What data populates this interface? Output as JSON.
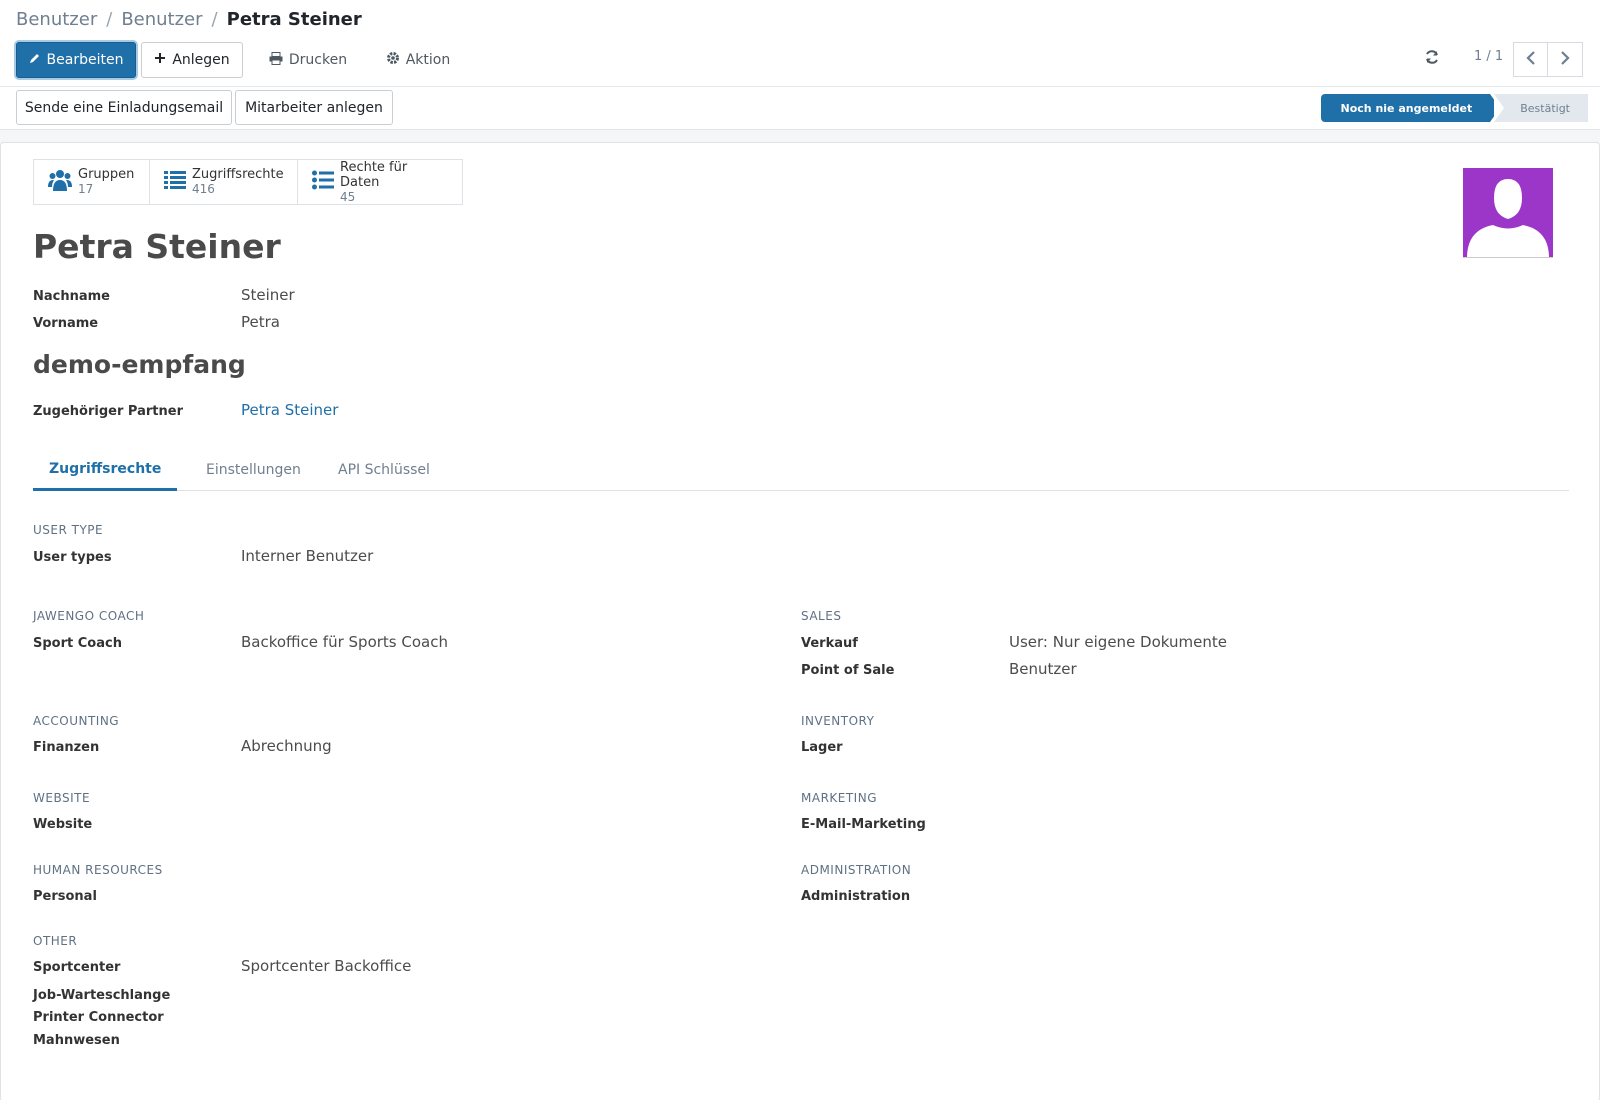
{
  "breadcrumb": {
    "items": [
      "Benutzer",
      "Benutzer",
      "Petra Steiner"
    ]
  },
  "toolbar": {
    "edit": "Bearbeiten",
    "create": "Anlegen",
    "print": "Drucken",
    "action": "Aktion"
  },
  "pager": {
    "value": "1 / 1"
  },
  "header_buttons": {
    "invite": "Sende eine Einladungsemail",
    "employee": "Mitarbeiter anlegen"
  },
  "status": {
    "current": "Noch nie angemeldet",
    "next": "Bestätigt"
  },
  "stats": [
    {
      "label": "Gruppen",
      "value": "17",
      "icon": "users-icon"
    },
    {
      "label": "Zugriffsrechte",
      "value": "416",
      "icon": "list-icon"
    },
    {
      "label": "Rechte für Daten",
      "value": "45",
      "icon": "list-ul-icon"
    }
  ],
  "user": {
    "name": "Petra Steiner",
    "lastname_label": "Nachname",
    "lastname": "Steiner",
    "firstname_label": "Vorname",
    "firstname": "Petra",
    "login": "demo-empfang",
    "partner_label": "Zugehöriger Partner",
    "partner": "Petra Steiner"
  },
  "tabs": [
    "Zugriffsrechte",
    "Einstellungen",
    "API Schlüssel"
  ],
  "access": {
    "user_type": {
      "head": "USER TYPE",
      "label": "User types",
      "value": "Interner Benutzer"
    },
    "coach": {
      "head": "JAWENGO COACH",
      "label": "Sport Coach",
      "value": "Backoffice für Sports Coach"
    },
    "sales": {
      "head": "SALES",
      "verkauf_label": "Verkauf",
      "verkauf_value": "User: Nur eigene Dokumente",
      "pos_label": "Point of Sale",
      "pos_value": "Benutzer"
    },
    "accounting": {
      "head": "ACCOUNTING",
      "label": "Finanzen",
      "value": "Abrechnung"
    },
    "inventory": {
      "head": "INVENTORY",
      "label": "Lager"
    },
    "website": {
      "head": "WEBSITE",
      "label": "Website"
    },
    "marketing": {
      "head": "MARKETING",
      "label": "E-Mail-Marketing"
    },
    "hr": {
      "head": "HUMAN RESOURCES",
      "label": "Personal"
    },
    "administration": {
      "head": "ADMINISTRATION",
      "label": "Administration"
    },
    "other": {
      "head": "OTHER",
      "sportcenter_label": "Sportcenter",
      "sportcenter_value": "Sportcenter Backoffice",
      "job_label": "Job-Warteschlange",
      "printer_label": "Printer Connector",
      "mahn_label": "Mahnwesen"
    }
  },
  "colors": {
    "primary": "#1f6fa8",
    "avatar": "#9b36c9"
  }
}
